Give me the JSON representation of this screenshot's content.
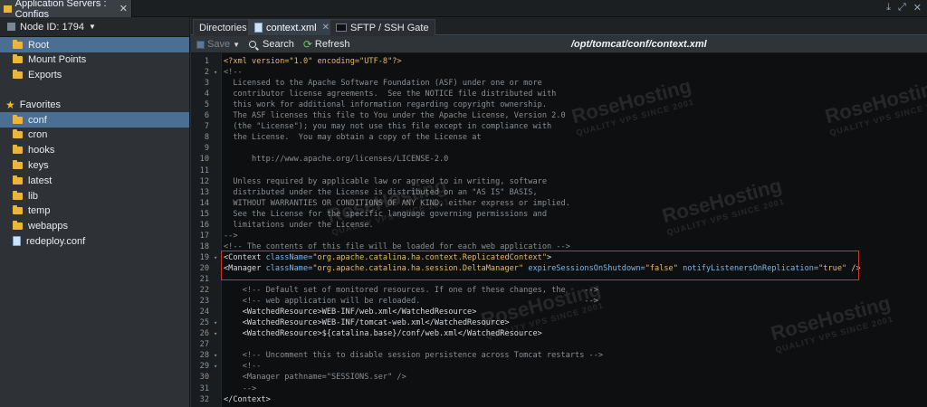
{
  "window": {
    "tab_title": "Application Servers : Configs",
    "close_glyph": "✕",
    "controls": [
      "⤓",
      "⤢",
      "✕"
    ]
  },
  "left_panel": {
    "node_label": "Node ID: 1794",
    "top_items": [
      {
        "label": "Root",
        "icon": "folder-icon",
        "selected": true
      },
      {
        "label": "Mount Points",
        "icon": "folder-icon"
      },
      {
        "label": "Exports",
        "icon": "folder-icon"
      }
    ],
    "favorites_label": "Favorites",
    "favorites": [
      {
        "label": "conf",
        "icon": "folder-icon",
        "selected": true
      },
      {
        "label": "cron",
        "icon": "folder-icon"
      },
      {
        "label": "hooks",
        "icon": "folder-icon"
      },
      {
        "label": "keys",
        "icon": "folder-icon"
      },
      {
        "label": "latest",
        "icon": "folder-icon"
      },
      {
        "label": "lib",
        "icon": "folder-icon"
      },
      {
        "label": "temp",
        "icon": "folder-icon"
      },
      {
        "label": "webapps",
        "icon": "folder-icon"
      },
      {
        "label": "redeploy.conf",
        "icon": "file-icon"
      }
    ]
  },
  "tabs": [
    {
      "label": "Directories"
    },
    {
      "label": "context.xml",
      "active": true,
      "closable": true
    },
    {
      "label": "SFTP / SSH Gate"
    }
  ],
  "toolbar": {
    "save_label": "Save",
    "search_label": "Search",
    "refresh_label": "Refresh",
    "path": "/opt/tomcat/conf/context.xml"
  },
  "editor": {
    "lines": [
      {
        "n": "1",
        "segs": [
          [
            "decl",
            "<?xml version=\"1.0\" encoding=\"UTF-8\"?>"
          ]
        ]
      },
      {
        "n": "2",
        "fold": true,
        "segs": [
          [
            "comment",
            "<!--"
          ]
        ]
      },
      {
        "n": "3",
        "segs": [
          [
            "comment",
            "  Licensed to the Apache Software Foundation (ASF) under one or more"
          ]
        ]
      },
      {
        "n": "4",
        "segs": [
          [
            "comment",
            "  contributor license agreements.  See the NOTICE file distributed with"
          ]
        ]
      },
      {
        "n": "5",
        "segs": [
          [
            "comment",
            "  this work for additional information regarding copyright ownership."
          ]
        ]
      },
      {
        "n": "6",
        "segs": [
          [
            "comment",
            "  The ASF licenses this file to You under the Apache License, Version 2.0"
          ]
        ]
      },
      {
        "n": "7",
        "segs": [
          [
            "comment",
            "  (the \"License\"); you may not use this file except in compliance with"
          ]
        ]
      },
      {
        "n": "8",
        "segs": [
          [
            "comment",
            "  the License.  You may obtain a copy of the License at"
          ]
        ]
      },
      {
        "n": "9",
        "segs": [
          [
            "comment",
            ""
          ]
        ]
      },
      {
        "n": "10",
        "segs": [
          [
            "comment",
            "      http://www.apache.org/licenses/LICENSE-2.0"
          ]
        ]
      },
      {
        "n": "11",
        "segs": [
          [
            "comment",
            ""
          ]
        ]
      },
      {
        "n": "12",
        "segs": [
          [
            "comment",
            "  Unless required by applicable law or agreed to in writing, software"
          ]
        ]
      },
      {
        "n": "13",
        "segs": [
          [
            "comment",
            "  distributed under the License is distributed on an \"AS IS\" BASIS,"
          ]
        ]
      },
      {
        "n": "14",
        "segs": [
          [
            "comment",
            "  WITHOUT WARRANTIES OR CONDITIONS OF ANY KIND, either express or implied."
          ]
        ]
      },
      {
        "n": "15",
        "segs": [
          [
            "comment",
            "  See the License for the specific language governing permissions and"
          ]
        ]
      },
      {
        "n": "16",
        "segs": [
          [
            "comment",
            "  limitations under the License."
          ]
        ]
      },
      {
        "n": "17",
        "segs": [
          [
            "comment",
            "-->"
          ]
        ]
      },
      {
        "n": "18",
        "segs": [
          [
            "comment",
            "<!-- The contents of this file will be loaded for each web application -->"
          ]
        ]
      },
      {
        "n": "19",
        "fold": true,
        "segs": [
          [
            "tag",
            "<Context "
          ],
          [
            "attr",
            "className="
          ],
          [
            "val",
            "\"org.apache.catalina.ha.context.ReplicatedContext\""
          ],
          [
            "tag",
            ">"
          ]
        ]
      },
      {
        "n": "20",
        "segs": [
          [
            "tag",
            "<Manager "
          ],
          [
            "attr",
            "className="
          ],
          [
            "val",
            "\"org.apache.catalina.ha.session.DeltaManager\""
          ],
          [
            "attr",
            " expireSessionsOnShutdown="
          ],
          [
            "val",
            "\"false\""
          ],
          [
            "attr",
            " notifyListenersOnReplication="
          ],
          [
            "val",
            "\"true\""
          ],
          [
            "tag",
            " />"
          ]
        ]
      },
      {
        "n": "21",
        "segs": [
          [
            "text",
            ""
          ]
        ]
      },
      {
        "n": "22",
        "segs": [
          [
            "comment",
            "    <!-- Default set of monitored resources. If one of these changes, the    -->"
          ]
        ]
      },
      {
        "n": "23",
        "segs": [
          [
            "comment",
            "    <!-- web application will be reloaded.                                   -->"
          ]
        ]
      },
      {
        "n": "24",
        "segs": [
          [
            "tag",
            "    <WatchedResource>"
          ],
          [
            "text",
            "WEB-INF/web.xml"
          ],
          [
            "tag",
            "</WatchedResource>"
          ]
        ]
      },
      {
        "n": "25",
        "fold": true,
        "segs": [
          [
            "tag",
            "    <WatchedResource>"
          ],
          [
            "text",
            "WEB-INF/tomcat-web.xml"
          ],
          [
            "tag",
            "</WatchedResource>"
          ]
        ]
      },
      {
        "n": "26",
        "fold": true,
        "segs": [
          [
            "tag",
            "    <WatchedResource>"
          ],
          [
            "text",
            "${catalina.base}/conf/web.xml"
          ],
          [
            "tag",
            "</WatchedResource>"
          ]
        ]
      },
      {
        "n": "27",
        "segs": [
          [
            "text",
            ""
          ]
        ]
      },
      {
        "n": "28",
        "fold": true,
        "segs": [
          [
            "comment",
            "    <!-- Uncomment this to disable session persistence across Tomcat restarts -->"
          ]
        ]
      },
      {
        "n": "29",
        "fold": true,
        "segs": [
          [
            "comment",
            "    <!--"
          ]
        ]
      },
      {
        "n": "30",
        "segs": [
          [
            "comment",
            "    <Manager pathname=\"SESSIONS.ser\" />"
          ]
        ]
      },
      {
        "n": "31",
        "segs": [
          [
            "comment",
            "    -->"
          ]
        ]
      },
      {
        "n": "32",
        "segs": [
          [
            "tag",
            "</Context>"
          ]
        ]
      }
    ]
  },
  "watermark": {
    "brand": "RoseHosting",
    "tagline": "QUALITY VPS SINCE 2001"
  }
}
